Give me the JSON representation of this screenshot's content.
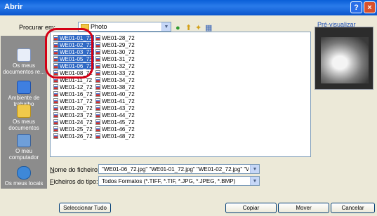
{
  "window": {
    "title": "Abrir",
    "help_glyph": "?",
    "close_glyph": "×"
  },
  "toolbar": {
    "look_in_label": "Procurar em:",
    "look_in_value": "Photo"
  },
  "places": [
    {
      "label": "Os meus documentos re..."
    },
    {
      "label": "Ambiente de trabalho"
    },
    {
      "label": "Os meus documentos"
    },
    {
      "label": "O meu computador"
    },
    {
      "label": "Os meus locais"
    }
  ],
  "files": {
    "column1": [
      "WE01-01_72",
      "WE01-02_72",
      "WE01-03_72",
      "WE01-05_72",
      "WE01-06_72",
      "WE01-08_72",
      "WE01-11_72",
      "WE01-12_72",
      "WE01-16_72",
      "WE01-17_72",
      "WE01-20_72",
      "WE01-23_72",
      "WE01-24_72",
      "WE01-25_72",
      "WE01-26_72"
    ],
    "column2": [
      "WE01-28_72",
      "WE01-29_72",
      "WE01-30_72",
      "WE01-31_72",
      "WE01-32_72",
      "WE01-33_72",
      "WE01-34_72",
      "WE01-38_72",
      "WE01-40_72",
      "WE01-41_72",
      "WE01-43_72",
      "WE01-44_72",
      "WE01-45_72",
      "WE01-46_72",
      "WE01-48_72"
    ],
    "selected": [
      "WE01-01_72",
      "WE01-02_72",
      "WE01-03_72",
      "WE01-05_72",
      "WE01-06_72"
    ]
  },
  "preview": {
    "label": "Pré-visualizar"
  },
  "filename": {
    "label": "Nome do ficheiro:",
    "value": "\"WE01-06_72.jpg\" \"WE01-01_72.jpg\" \"WE01-02_72.jpg\" \"WE01-03_"
  },
  "filetype": {
    "label": "Ficheiros do tipo:",
    "value": "Todos Formatos (*.TIFF, *.TIF, *.JPG, *.JPEG, *.BMP)"
  },
  "buttons": {
    "select_all": "Seleccionar Tudo",
    "copy": "Copiar",
    "move": "Mover",
    "cancel": "Cancelar"
  },
  "colors": {
    "selection": "#316ac5",
    "highlight_ring": "#d40014",
    "titlebar": "#0a5fd8"
  }
}
